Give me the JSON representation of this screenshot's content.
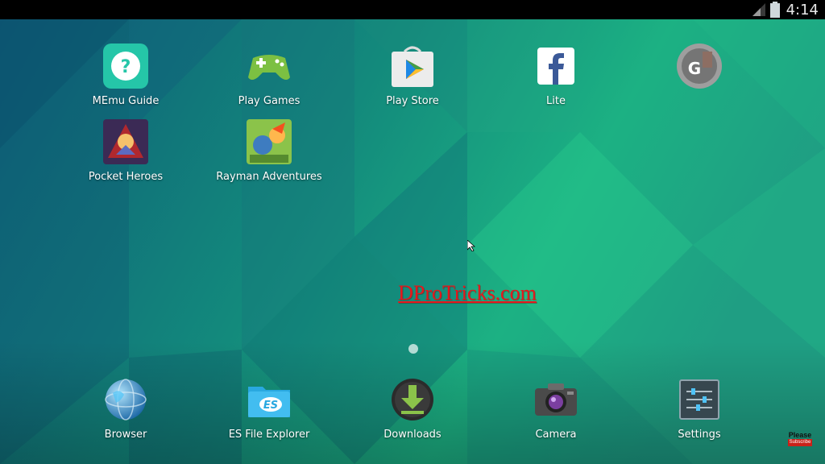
{
  "status_bar": {
    "time": "4:14",
    "icons": [
      "signal-icon",
      "battery-icon"
    ]
  },
  "apps": [
    {
      "label": "MEmu Guide",
      "icon": "memu-guide-icon"
    },
    {
      "label": "Play Games",
      "icon": "play-games-icon"
    },
    {
      "label": "Play Store",
      "icon": "play-store-icon"
    },
    {
      "label": "Lite",
      "icon": "facebook-lite-icon"
    },
    {
      "label": "",
      "icon": "google-settings-icon"
    },
    {
      "label": "Pocket Heroes",
      "icon": "pocket-heroes-icon"
    },
    {
      "label": "Rayman Adventures",
      "icon": "rayman-adventures-icon"
    }
  ],
  "dock": [
    {
      "label": "Browser",
      "icon": "browser-globe-icon"
    },
    {
      "label": "ES File Explorer",
      "icon": "es-file-explorer-icon"
    },
    {
      "label": "Downloads",
      "icon": "downloads-icon"
    },
    {
      "label": "Camera",
      "icon": "camera-icon"
    },
    {
      "label": "Settings",
      "icon": "settings-sliders-icon"
    }
  ],
  "watermark": "DProTricks.com",
  "subscribe": {
    "please": "Please",
    "button": "Subscribe"
  },
  "colors": {
    "wallpaper_dark": "#0e5c78",
    "wallpaper_mid": "#138a7c",
    "wallpaper_light": "#22c58a",
    "watermark": "#e8161b"
  }
}
